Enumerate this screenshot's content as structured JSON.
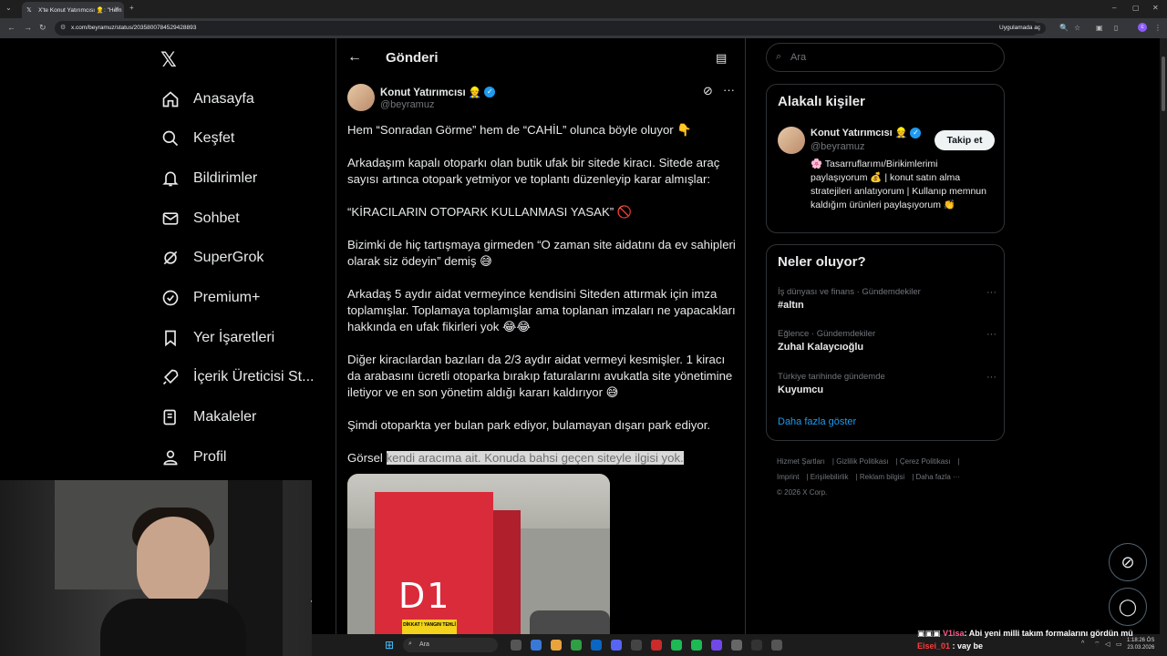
{
  "browser": {
    "tab_title": "X'te Konut Yatırımcısı 👷: \"Hem",
    "url": "x.com/beyramuz/status/2035800784529428893",
    "open_in_app": "Uygulamada aç",
    "profile_initial": "c"
  },
  "sidebar": {
    "items": [
      {
        "label": "Anasayfa",
        "icon": "home-icon"
      },
      {
        "label": "Keşfet",
        "icon": "search-icon"
      },
      {
        "label": "Bildirimler",
        "icon": "bell-icon"
      },
      {
        "label": "Sohbet",
        "icon": "mail-icon"
      },
      {
        "label": "SuperGrok",
        "icon": "grok-icon"
      },
      {
        "label": "Premium+",
        "icon": "verified-icon"
      },
      {
        "label": "Yer İşaretleri",
        "icon": "bookmark-icon"
      },
      {
        "label": "İçerik Üreticisi St...",
        "icon": "rocket-icon"
      },
      {
        "label": "Makaleler",
        "icon": "article-icon"
      },
      {
        "label": "Profil",
        "icon": "person-icon"
      }
    ]
  },
  "main": {
    "header_title": "Gönderi",
    "author": {
      "name": "Konut Yatırımcısı 👷",
      "handle": "@beyramuz"
    },
    "paragraphs": [
      "Hem “Sonradan Görme” hem de “CAHİL” olunca böyle oluyor 👇",
      "Arkadaşım kapalı otoparkı olan butik ufak bir sitede kiracı. Sitede araç sayısı artınca otopark yetmiyor ve toplantı düzenleyip karar almışlar:",
      "“KİRACILARIN OTOPARK KULLANMASI YASAK” 🚫",
      "Bizimki de hiç tartışmaya girmeden “O zaman site aidatını da ev sahipleri olarak siz ödeyin” demiş 😅",
      "Arkadaş 5 aydır aidat vermeyince kendisini Siteden attırmak için imza toplamışlar. Toplamaya toplamışlar ama toplanan imzaları ne yapacakları hakkında en ufak fikirleri yok 😂😂",
      "Diğer kiracılardan bazıları da 2/3 aydır aidat vermeyi kesmişler. 1 kiracı da arabasını ücretli otoparka bırakıp faturalarını avukatla site yönetimine iletiyor ve en son yönetim aldığı kararı kaldırıyor 😅",
      "Şimdi otoparkta yer bulan park ediyor, bulamayan dışarı park ediyor."
    ],
    "last_prefix": "Görsel ",
    "last_highlight": "kendi aracıma ait. Konuda bahsi geçen siteyle ilgisi yok.",
    "media": {
      "pillar_label": "D1",
      "sign_text": "DİKKAT ! YANGIN TEHLİ"
    }
  },
  "right": {
    "search_placeholder": "Ara",
    "related": {
      "title": "Alakalı kişiler",
      "name": "Konut Yatırımcısı 👷",
      "handle": "@beyramuz",
      "follow": "Takip et",
      "bio": "🌸 Tasarruflarımı/Birikimlerimi paylaşıyorum 💰 | konut satın alma stratejileri anlatıyorum | Kullanıp memnun kaldığım ürünleri paylaşıyorum 👏"
    },
    "trends": {
      "title": "Neler oluyor?",
      "items": [
        {
          "category": "İş dünyası ve finans · Gündemdekiler",
          "title": "#altın"
        },
        {
          "category": "Eğlence · Gündemdekiler",
          "title": "Zuhal Kalaycıoğlu"
        },
        {
          "category": "Türkiye tarihinde gündemde",
          "title": "Kuyumcu"
        }
      ],
      "show_more": "Daha fazla göster"
    },
    "footer": {
      "links": [
        "Hizmet Şartları",
        "Gizlilik Politikası",
        "Çerez Politikası",
        "Imprint",
        "Erişilebilirlik",
        "Reklam bilgisi",
        "Daha fazla ···"
      ],
      "copyright": "© 2026 X Corp."
    }
  },
  "taskbar": {
    "search_label": "Ara",
    "time": "1:18:26 ÖS",
    "date": "23.03.2026"
  },
  "chat": {
    "messages": [
      {
        "user": "V1isa",
        "text": ": Abi yeni milli takım formalarını gördün mü"
      },
      {
        "user": "Eisei_01",
        "text": ": vay be"
      }
    ]
  },
  "colors": {
    "accent": "#1d9bf0",
    "background": "#000000",
    "border": "#2f3336",
    "muted": "#71767b"
  }
}
